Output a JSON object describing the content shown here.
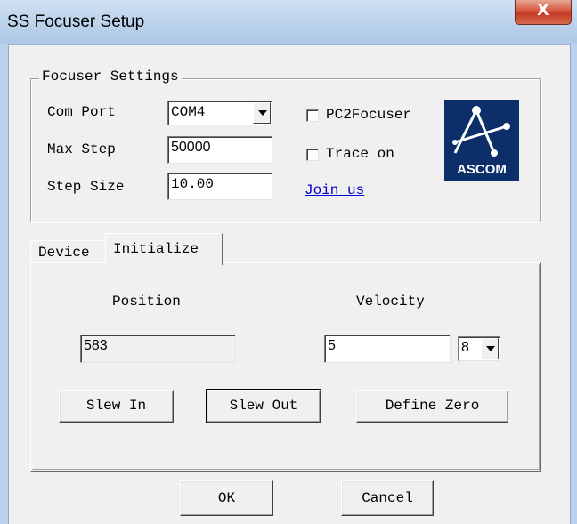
{
  "window": {
    "title": "SS Focuser Setup",
    "close_label": "X"
  },
  "settings": {
    "group_title": "Focuser Settings",
    "com_port_label": "Com Port",
    "com_port_value": "COM4",
    "max_step_label": "Max Step",
    "max_step_value": "50000",
    "step_size_label": "Step Size",
    "step_size_value": "10.00",
    "pc2focuser_label": "PC2Focuser",
    "pc2focuser_checked": false,
    "trace_label": "Trace on",
    "trace_checked": false,
    "join_label": "Join us",
    "logo_text": "ASCOM"
  },
  "tabs": [
    {
      "label": "Device",
      "active": false
    },
    {
      "label": "Initialize",
      "active": true
    }
  ],
  "initialize": {
    "position_label": "Position",
    "position_value": "583",
    "velocity_label": "Velocity",
    "velocity_value": "5",
    "velocity_select_value": "8",
    "slew_in_label": "Slew In",
    "slew_out_label": "Slew Out",
    "define_zero_label": "Define Zero"
  },
  "footer": {
    "ok_label": "OK",
    "cancel_label": "Cancel"
  },
  "colors": {
    "title_bar": "#b9d1ea",
    "close_button": "#c23a22",
    "logo_bg": "#0c2f6a",
    "link": "#0000cc"
  }
}
